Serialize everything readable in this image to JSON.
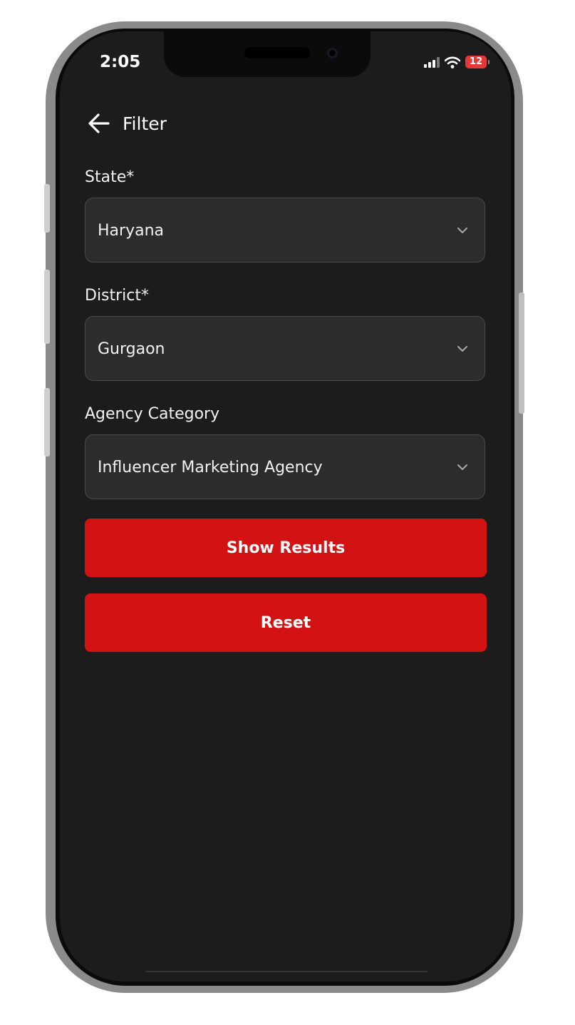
{
  "status_bar": {
    "time": "2:05",
    "battery_level": "12",
    "icons": [
      "cellular-signal-icon",
      "wifi-icon",
      "battery-icon"
    ]
  },
  "header": {
    "title": "Filter",
    "back_icon": "arrow-left-icon"
  },
  "fields": [
    {
      "label": "State*",
      "value": "Haryana"
    },
    {
      "label": "District*",
      "value": "Gurgaon"
    },
    {
      "label": "Agency Category",
      "value": "Influencer Marketing Agency"
    }
  ],
  "buttons": {
    "show_results": "Show Results",
    "reset": "Reset"
  },
  "colors": {
    "background": "#1c1c1c",
    "field_background": "#2c2c2c",
    "primary_button": "#d31213",
    "battery": "#e53935"
  }
}
